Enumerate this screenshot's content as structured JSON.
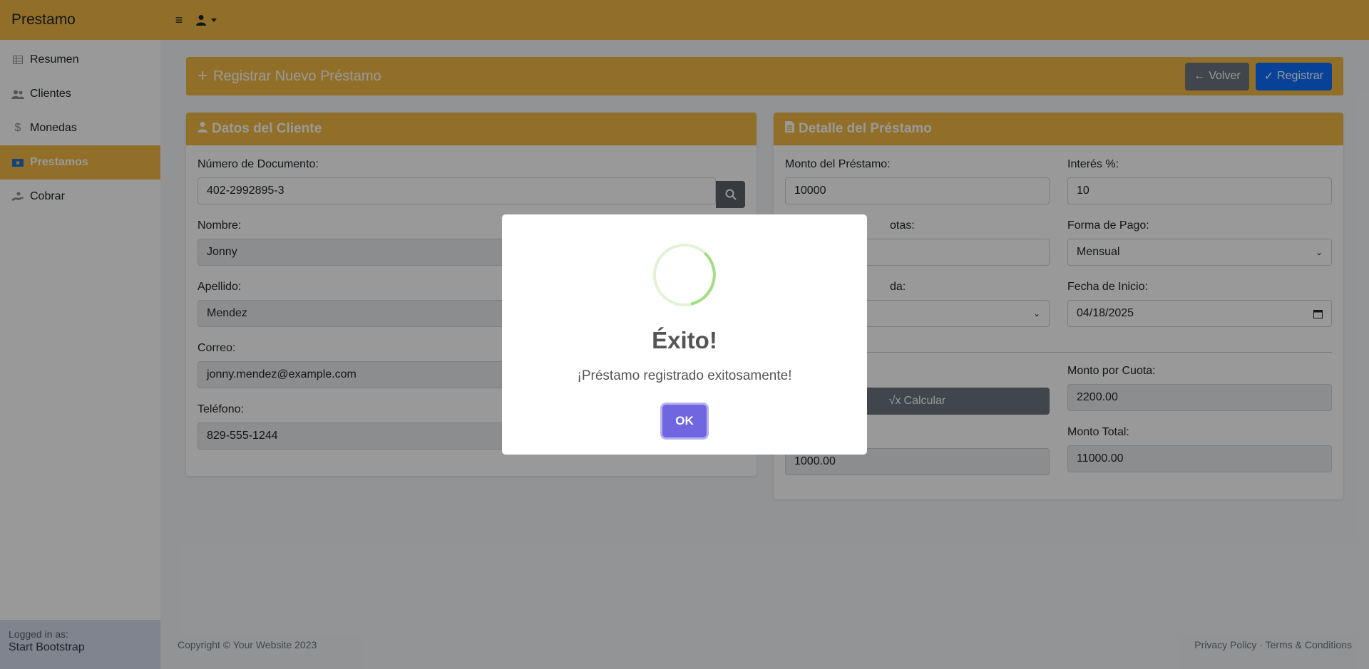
{
  "navbar": {
    "brand": "Prestamo",
    "menu_icon": "hamburger-icon",
    "user_icon": "user-icon"
  },
  "sidebar": {
    "items": [
      {
        "label": "Resumen",
        "icon": "table-icon",
        "active": false
      },
      {
        "label": "Clientes",
        "icon": "users-icon",
        "active": false
      },
      {
        "label": "Monedas",
        "icon": "dollar-icon",
        "active": false
      },
      {
        "label": "Prestamos",
        "icon": "money-bill-icon",
        "active": true
      },
      {
        "label": "Cobrar",
        "icon": "hand-holding-dollar-icon",
        "active": false
      }
    ],
    "footer_small": "Logged in as:",
    "footer_user": "Start Bootstrap"
  },
  "header": {
    "title": "Registrar Nuevo Préstamo",
    "back_label": "Volver",
    "register_label": "Registrar"
  },
  "cliente": {
    "title": "Datos del Cliente",
    "doc_label": "Número de Documento:",
    "doc_value": "402-2992895-3",
    "nombre_label": "Nombre:",
    "nombre_value": "Jonny",
    "apellido_label": "Apellido:",
    "apellido_value": "Mendez",
    "correo_label": "Correo:",
    "correo_value": "jonny.mendez@example.com",
    "telefono_label": "Teléfono:",
    "telefono_value": "829-555-1244"
  },
  "detalle": {
    "title": "Detalle del Préstamo",
    "monto_label": "Monto del Préstamo:",
    "monto_value": "10000",
    "interes_label": "Interés %:",
    "interes_value": "10",
    "cuotas_label_visible": "otas:",
    "forma_label": "Forma de Pago:",
    "forma_value": "Mensual",
    "moneda_label_visible": "da:",
    "fecha_label": "Fecha de Inicio:",
    "fecha_value": "04/18/2025",
    "calcular_label": "Calcular",
    "monto_cuota_label": "Monto por Cuota:",
    "monto_cuota_value": "2200.00",
    "interes_total_value": "1000.00",
    "monto_total_label": "Monto Total:",
    "monto_total_value": "11000.00"
  },
  "footer": {
    "copyright": "Copyright © Your Website 2023",
    "privacy": "Privacy Policy",
    "separator": "·",
    "terms": "Terms & Conditions"
  },
  "modal": {
    "title": "Éxito!",
    "text": "¡Préstamo registrado exitosamente!",
    "ok_label": "OK"
  },
  "colors": {
    "accent": "#f2b945",
    "primary": "#0d6efd",
    "secondary": "#6c757d",
    "modal_button": "#7066e0",
    "success": "#a5dc86"
  }
}
